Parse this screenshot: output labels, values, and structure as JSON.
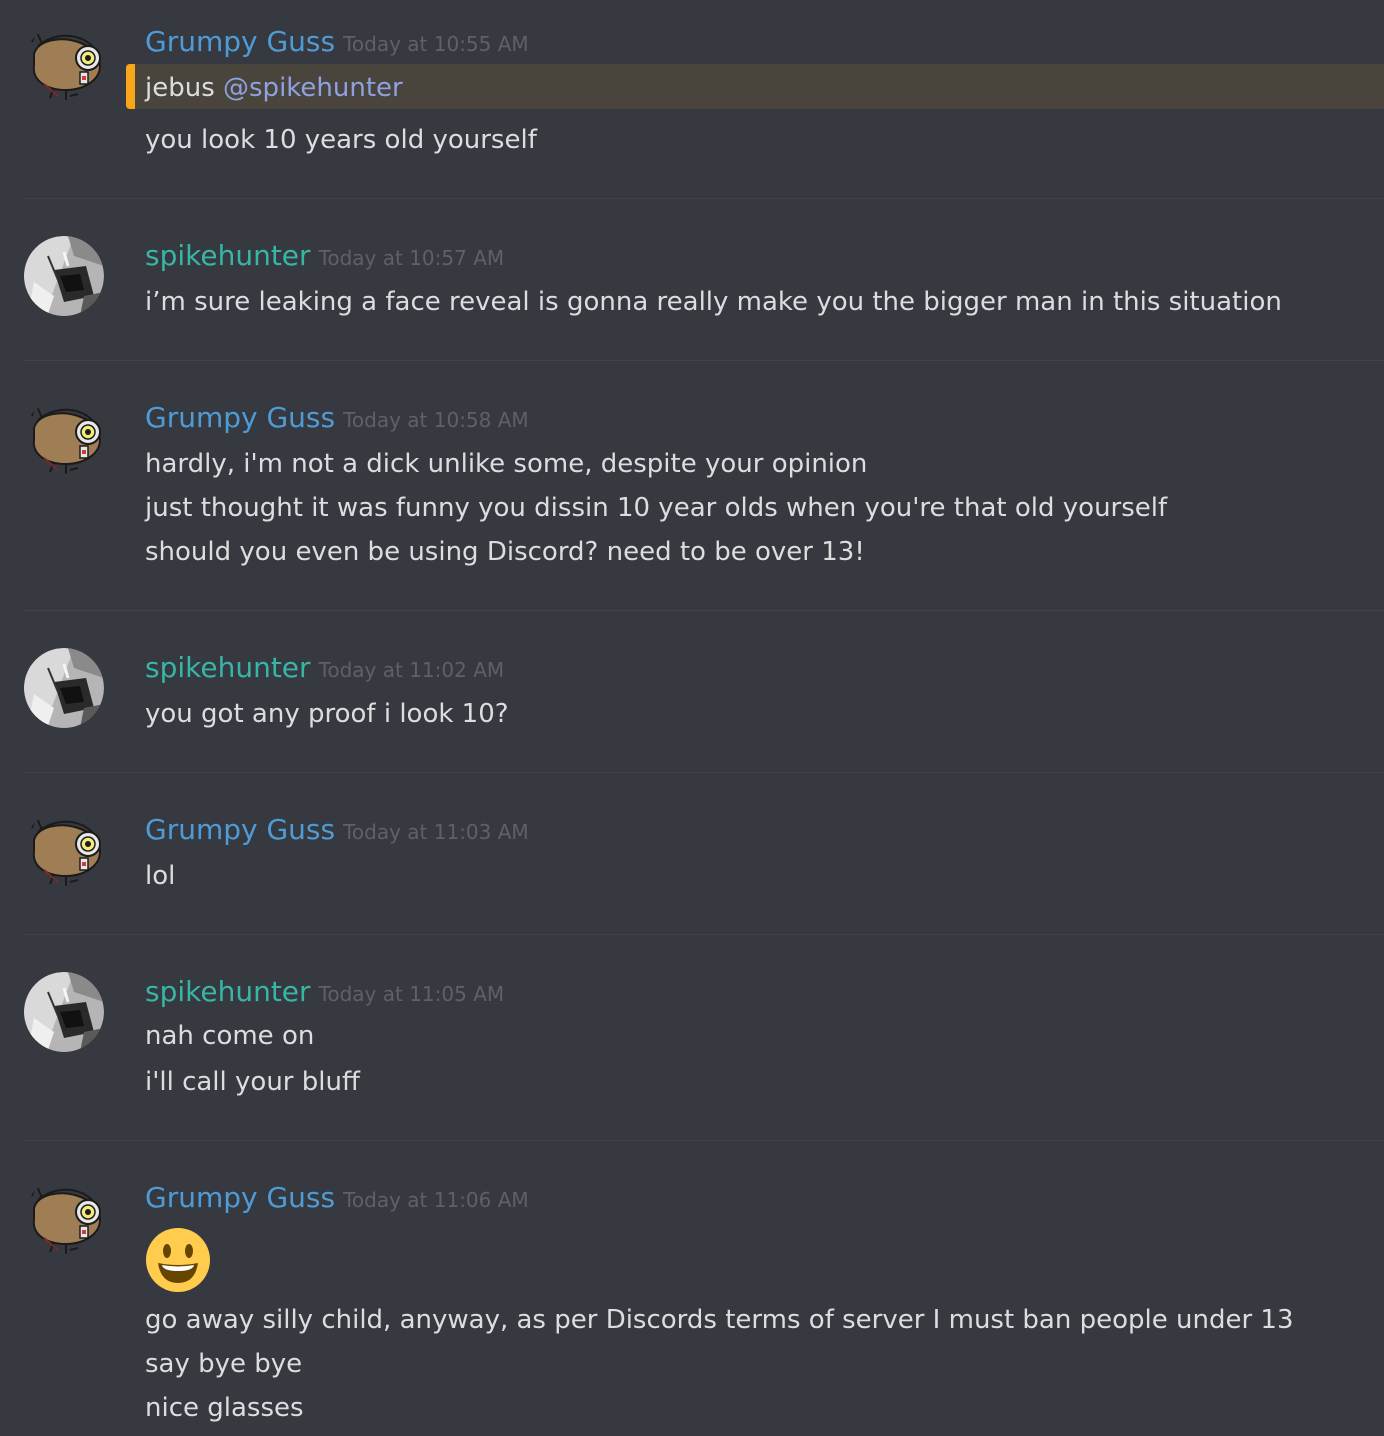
{
  "messages": [
    {
      "author": "Grumpy Guss",
      "timestamp": "Today at 10:55 AM",
      "lines": [
        "jebus",
        "@spikehunter",
        "you look 10 years old yourself"
      ]
    },
    {
      "author": "spikehunter",
      "timestamp": "Today at 10:57 AM",
      "lines": [
        "i’m sure leaking a face reveal is gonna really make you the bigger man in this situation"
      ]
    },
    {
      "author": "Grumpy Guss",
      "timestamp": "Today at 10:58 AM",
      "lines": [
        "hardly, i'm not a dick unlike some, despite your opinion",
        "just thought it was funny you dissin 10 year olds when you're that old yourself",
        "should you even be using Discord?  need to be over 13!"
      ]
    },
    {
      "author": "spikehunter",
      "timestamp": "Today at 11:02 AM",
      "lines": [
        "you got any proof i look 10?"
      ]
    },
    {
      "author": "Grumpy Guss",
      "timestamp": "Today at 11:03 AM",
      "lines": [
        "lol"
      ]
    },
    {
      "author": "spikehunter",
      "timestamp": "Today at 11:05 AM",
      "lines": [
        "nah come on",
        "i'll call your bluff"
      ]
    },
    {
      "author": "Grumpy Guss",
      "timestamp": "Today at 11:06 AM",
      "emoji": "smiley-emoji",
      "lines": [
        "go away silly child, anyway, as per Discords terms of server I must ban people under 13",
        "say bye bye",
        "nice glasses"
      ]
    }
  ],
  "colors": {
    "background": "#36393f",
    "guss_name": "#4f9bd6",
    "spike_name": "#38b5a6",
    "mention": "#8ea1e1",
    "mention_highlight": "#49443c",
    "mention_bar": "#faa61a"
  },
  "icons": {
    "guss_avatar": "kiwi-bird-avatar-icon",
    "spike_avatar": "grayscale-photo-avatar-icon"
  }
}
